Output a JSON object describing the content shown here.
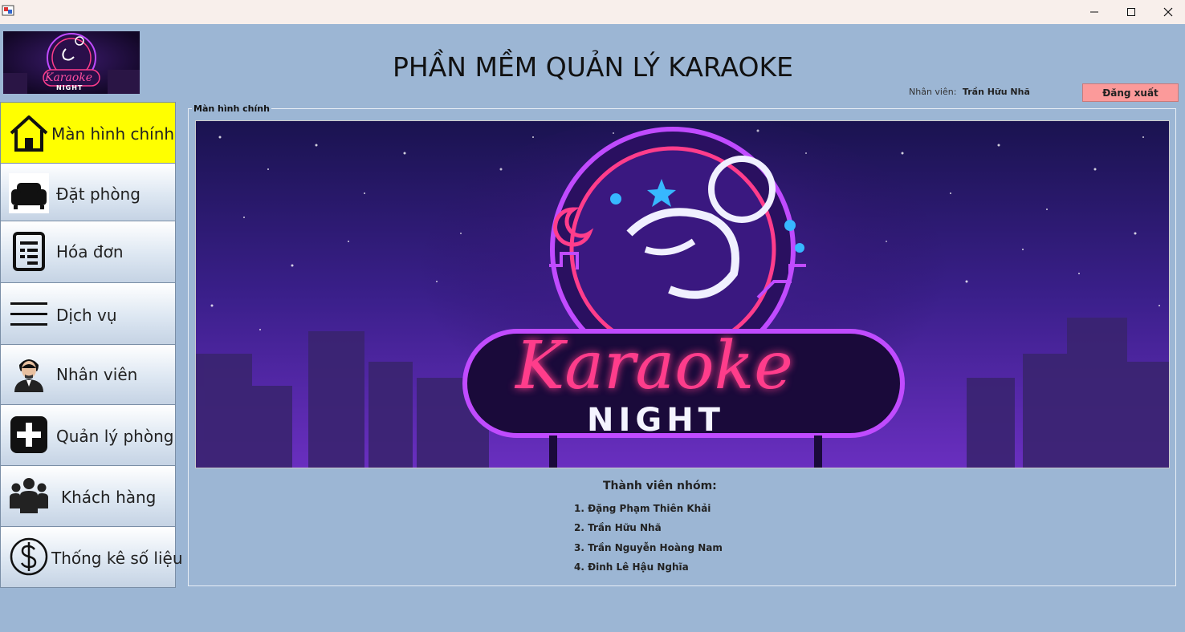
{
  "window": {
    "minimize_icon": "minimize-icon",
    "maximize_icon": "maximize-icon",
    "close_icon": "close-icon"
  },
  "header": {
    "title": "PHẦN MỀM QUẢN LÝ KARAOKE",
    "user_label": "Nhân viên:",
    "user_name": "Trần Hữu Nhã",
    "logout_label": "Đăng xuất",
    "logo_text": "Karaoke",
    "logo_subtext": "NIGHT"
  },
  "sidebar": {
    "items": [
      {
        "label": "Màn hình chính",
        "icon": "home-icon"
      },
      {
        "label": "Đặt phòng",
        "icon": "sofa-icon"
      },
      {
        "label": "Hóa đơn",
        "icon": "invoice-icon"
      },
      {
        "label": "Dịch vụ",
        "icon": "menu-icon"
      },
      {
        "label": "Nhân viên",
        "icon": "employee-icon"
      },
      {
        "label": "Quản lý phòng",
        "icon": "plus-icon"
      },
      {
        "label": "Khách hàng",
        "icon": "customers-icon"
      },
      {
        "label": "Thống kê số liệu",
        "icon": "dollar-icon"
      }
    ]
  },
  "main": {
    "panel_title": "Màn hình chính",
    "banner_text": "Karaoke",
    "banner_subtext": "NIGHT",
    "members_title": "Thành viên nhóm:",
    "members": [
      "1. Đặng Phạm Thiên Khải",
      "2. Trần Hữu Nhã",
      "3. Trần Nguyễn Hoàng Nam",
      "4. Đinh Lê Hậu Nghĩa"
    ]
  },
  "colors": {
    "background": "#9cb6d4",
    "active_nav": "#ffff00",
    "logout": "#fb9a9a",
    "neon_pink": "#ff3d8b",
    "neon_purple": "#c04bff"
  }
}
